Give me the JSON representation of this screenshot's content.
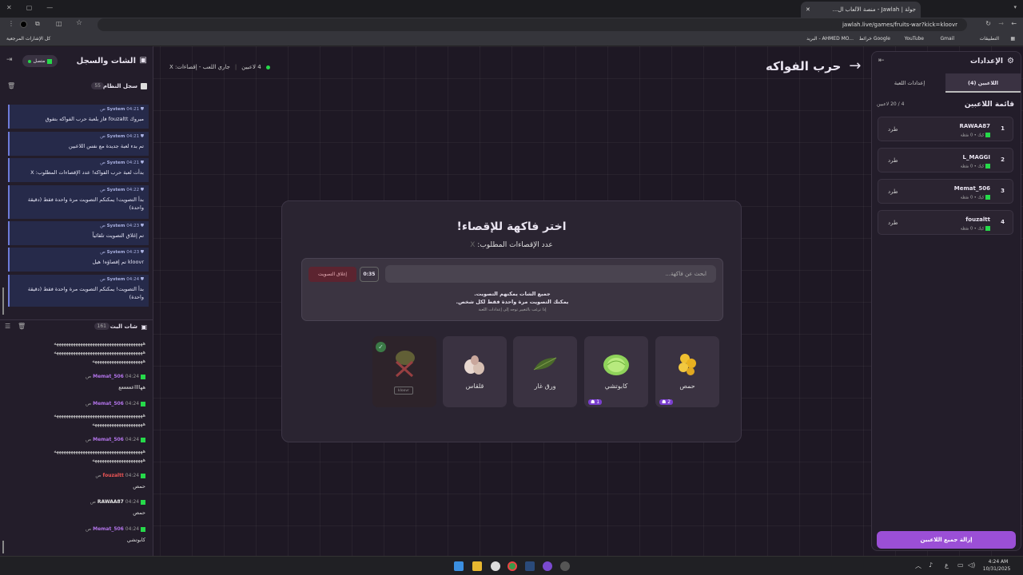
{
  "browser": {
    "tab_title": "جولة | Jawlah - منصة الألعاب ال...",
    "url": "jawlah.live/games/fruits-war?kick=kloovr",
    "bookmarks": [
      "التطبيقات",
      "Gmail",
      "YouTube",
      "خرائط Google",
      "البريد - AHMED MO...",
      "كل الإشارات المرجعية"
    ]
  },
  "left": {
    "title": "الشات والسجل",
    "status": "متصل",
    "system_log": {
      "title": "سجل النظام",
      "count": "55",
      "messages": [
        {
          "author": "System",
          "time": "04:21 ص",
          "text": "مبروك fouzaltt فاز بلعبة حرب الفواكه بتفوق"
        },
        {
          "author": "System",
          "time": "04:21 ص",
          "text": "تم بدء لعبة جديدة مع نفس اللاعبين"
        },
        {
          "author": "System",
          "time": "04:21 ص",
          "text": "بدأت لعبة حرب الفواكه! عدد الإقصاءات المطلوب: X"
        },
        {
          "author": "System",
          "time": "04:22 ص",
          "text": "بدأ التصويت! يمكنكم التصويت مرة واحدة فقط (دقيقة واحدة)"
        },
        {
          "author": "System",
          "time": "04:23 ص",
          "text": "تم إغلاق التصويت تلقائياً"
        },
        {
          "author": "System",
          "time": "04:23 ص",
          "text": "kloovr تم إقصاؤه! هيل"
        },
        {
          "author": "System",
          "time": "04:24 ص",
          "text": "بدأ التصويت! يمكنكم التصويت مرة واحدة فقط (دقيقة واحدة)"
        }
      ]
    },
    "live_chat": {
      "title": "شات البث",
      "count": "161",
      "messages": [
        {
          "author": "",
          "time": "",
          "text": "هههههههههههههههههههههههههههههههههههههه\nهههههههههههههههههههههههههههههههههههههه\nهههههههههههههههههههههه"
        },
        {
          "author": "Memat_506",
          "time": "04:24 ص",
          "text": "ههااااعععععع"
        },
        {
          "author": "Memat_506",
          "time": "04:24 ص",
          "text": "هههههههههههههههههههههههههههههههههههههه\nهههههههههههههههههههههه"
        },
        {
          "author": "Memat_506",
          "time": "04:24 ص",
          "text": "هههههههههههههههههههههههههههههههههههههه\nهههههههههههههههههههههه"
        },
        {
          "author": "fouzaltt",
          "time": "04:24 ص",
          "text": "حمص"
        },
        {
          "author": "RAWAA87",
          "time": "04:24 ص",
          "text": "حمص"
        },
        {
          "author": "Memat_506",
          "time": "04:24 ص",
          "text": "كابوتشي"
        }
      ]
    }
  },
  "header": {
    "game_title": "حرب الفواكه",
    "status_players": "4 لاعبين",
    "status_playing": "جاري اللعب - إقصاءات: X"
  },
  "modal": {
    "title": "اختر فاكهة للإقصاء!",
    "subtitle": "عدد الإقصاءات المطلوب:",
    "subtitle_value": "X",
    "search_placeholder": "ابحث عن فاكهة...",
    "timer": "0:35",
    "close_vote": "إغلاق التصويت",
    "info_line1": "جميع الشات يمكنهم التصويت.",
    "info_line2": "يمكنك التصويت مرة واحدة فقط لكل شخص.",
    "info_line3": "إذا ترغب بالتغيير توجه إلى إعدادات اللعبة",
    "fruits": [
      {
        "name": "حمص",
        "votes": "2"
      },
      {
        "name": "كابوتشي",
        "votes": "1"
      },
      {
        "name": "ورق غار",
        "votes": ""
      },
      {
        "name": "قلقاس",
        "votes": ""
      },
      {
        "name": "",
        "tag": "kloovr",
        "eliminated": true
      }
    ]
  },
  "right": {
    "title": "الإعدادات",
    "tabs": [
      "اللاعبين (4)",
      "إعدادات اللعبة"
    ],
    "list_title": "قائمة اللاعبين",
    "count": "4 / 20 لاعبين",
    "players": [
      {
        "rank": "1",
        "name": "RAWAA87",
        "sub": "كيك • 0 نقطة",
        "kick": "طرد"
      },
      {
        "rank": "2",
        "name": "L_MAGGI",
        "sub": "كيك • 0 نقطة",
        "kick": "طرد"
      },
      {
        "rank": "3",
        "name": "Memat_506",
        "sub": "كيك • 0 نقطة",
        "kick": "طرد"
      },
      {
        "rank": "4",
        "name": "fouzaltt",
        "sub": "كيك • 0 نقطة",
        "kick": "طرد"
      }
    ],
    "remove_all": "إزالة جميع اللاعبين"
  },
  "taskbar": {
    "time": "4:24 AM",
    "date": "10/31/2025",
    "lang": "ع"
  },
  "colors": {
    "accent": "#9b4fd6",
    "kick_green": "#26d94a",
    "system_blue": "#6e7bd8"
  }
}
